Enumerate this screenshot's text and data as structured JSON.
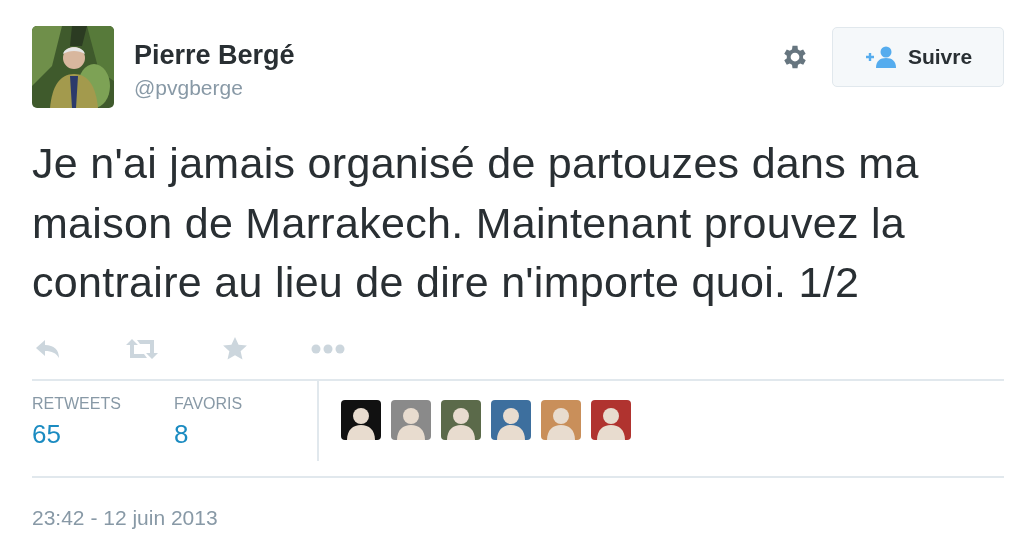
{
  "author": {
    "name": "Pierre Bergé",
    "handle": "@pvgberge"
  },
  "follow_button": {
    "label": "Suivre"
  },
  "tweet": {
    "text": "Je n'ai jamais organisé de partouzes dans ma maison de Marrakech. Maintenant prouvez la contraire au lieu de dire n'importe quoi. 1/2"
  },
  "actions": [
    {
      "kind": "reply"
    },
    {
      "kind": "retweet"
    },
    {
      "kind": "favorite"
    },
    {
      "kind": "more"
    }
  ],
  "stats": [
    {
      "label": "RETWEETS",
      "value": "65"
    },
    {
      "label": "FAVORIS",
      "value": "8"
    }
  ],
  "favorited_by": [
    {
      "color": "#111111"
    },
    {
      "color": "#8a8a8a"
    },
    {
      "color": "#5b6a4a"
    },
    {
      "color": "#3d6f9e"
    },
    {
      "color": "#c98f5a"
    },
    {
      "color": "#b0332f"
    }
  ],
  "timestamp": "23:42 - 12 juin 2013"
}
